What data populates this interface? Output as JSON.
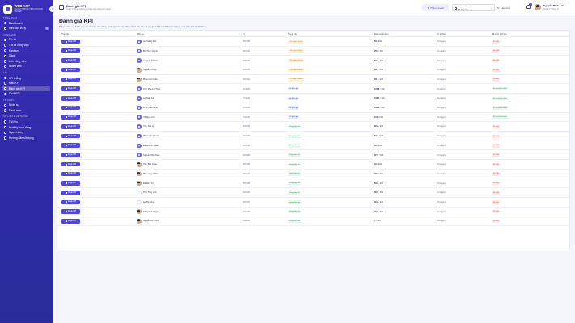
{
  "brand": {
    "name": "WEB APP",
    "subtitle": "QUẢN LÝ NHÂN VIÊN CHUYÊN NGHIỆP"
  },
  "sidebar": {
    "sections": [
      {
        "label": "TỔNG QUAN",
        "items": [
          {
            "label": "Dashboard",
            "active": false
          },
          {
            "label": "Việc cần xử lý",
            "active": false,
            "badge": "3"
          }
        ]
      },
      {
        "label": "CÔNG VIỆC",
        "items": [
          {
            "label": "Dự án",
            "active": false
          },
          {
            "label": "Tất cả công việc",
            "active": false
          },
          {
            "label": "Kanban",
            "active": false
          },
          {
            "label": "Gantt",
            "active": false
          },
          {
            "label": "Lịch công việc",
            "active": false
          },
          {
            "label": "Nhiều việc",
            "active": false
          }
        ]
      },
      {
        "label": "KPI",
        "items": [
          {
            "label": "KPI thẳng",
            "active": false
          },
          {
            "label": "Mẫu KPI",
            "active": false
          },
          {
            "label": "Đánh giá KPI",
            "active": true
          },
          {
            "label": "Chốt KPI",
            "active": false
          }
        ]
      },
      {
        "label": "TỔ CHỨC",
        "items": [
          {
            "label": "Nhân sự",
            "active": false
          },
          {
            "label": "Danh mục",
            "active": false
          }
        ]
      },
      {
        "label": "DỮ LIỆU & HỆ THỐNG",
        "items": [
          {
            "label": "Tài liệu",
            "active": false
          },
          {
            "label": "Nhật ký hoạt động",
            "active": false
          },
          {
            "label": "Người dùng",
            "active": false
          },
          {
            "label": "Hướng dẫn sử dụng",
            "active": false
          }
        ]
      }
    ]
  },
  "topbar": {
    "title": "Đánh giá KPI",
    "subtitle": "Quản lý đánh giá quy chỉ tiêu cho nhân viên hàng",
    "action_label": "Thêm nhanh",
    "month_label": "Chọn tháng",
    "month_value": "Tháng này",
    "refresh_label": "Làm mới",
    "notif_count": "3",
    "user_name": "Nguyễn Minh Anh",
    "user_role": "Quản lý | Quản trị"
  },
  "page": {
    "title": "Đánh giá KPI",
    "description": "Phiên nhân sự đánh giá các chỉ tiêu cần thiệp, quản lý kiểm tra, điều chỉnh kết cần và duyệt. Chỉ sau khi bản hài lòng, mới tính KPI chính thức."
  },
  "table": {
    "headers": [
      "Thao tác",
      "Nhân sự",
      "Kỳ",
      "Trạng thái",
      "Điểm hoàn thiện",
      "Xử lý/thao",
      "Đã hoàn tất/chưa"
    ],
    "action_label": "Duyệt KPI",
    "rows": [
      {
        "name": "Lê Hoàng Sơn",
        "avatar": "init",
        "period": "06/2026",
        "status": "Chờ quản lý duyệt",
        "status_type": "wait",
        "score": "53",
        "max": "/ 100",
        "handling": "Chưa gửi",
        "completion": "Đã chốt",
        "completion_type": "no"
      },
      {
        "name": "Bùi Thúy Quỳnh",
        "avatar": "init",
        "period": "06/2026",
        "status": "Chờ quản lý duyệt",
        "status_type": "wait",
        "score": "25.6",
        "max": "/ 100",
        "handling": "Chưa gửi",
        "completion": "Đã chốt",
        "completion_type": "no"
      },
      {
        "name": "Lê Quốc Khánh",
        "avatar": "init",
        "period": "06/2026",
        "status": "Chờ quản lý duyệt",
        "status_type": "wait",
        "score": "69.8",
        "max": "/ 100",
        "handling": "Chưa gửi",
        "completion": "Đã chốt",
        "completion_type": "no"
      },
      {
        "name": "Nguyễn Hà My",
        "avatar": "photo",
        "period": "06/2026",
        "status": "Chờ quản lý duyệt",
        "status_type": "wait",
        "score": "93.1",
        "max": "/ 100",
        "handling": "Chưa gửi",
        "completion": "Đã chốt",
        "completion_type": "no"
      },
      {
        "name": "Phạm Anh Tuấn",
        "avatar": "photo",
        "period": "06/2026",
        "status": "Chờ quản lý duyệt",
        "status_type": "wait",
        "score": "53.1",
        "max": "/ 100",
        "handling": "Chưa gửi",
        "completion": "Đã chốt",
        "completion_type": "no"
      },
      {
        "name": "Trần Phương Thảo",
        "avatar": "init",
        "period": "07/2026",
        "status": "Đã đánh giá",
        "status_type": "done",
        "score": "101.5",
        "max": "/ 100",
        "handling": "Chưa gửi",
        "completion": "Đã có ý kiến nhập",
        "completion_type": "ok"
      },
      {
        "name": "Lê Tuấn Anh",
        "avatar": "init",
        "period": "07/2026",
        "status": "Đã đánh giá",
        "status_type": "done",
        "score": "103.1",
        "max": "/ 100",
        "handling": "Chưa gửi",
        "completion": "Đã có ý kiến nhập",
        "completion_type": "ok"
      },
      {
        "name": "Phạm Bảo Minh",
        "avatar": "init",
        "period": "07/2026",
        "status": "Đã đánh giá",
        "status_type": "done",
        "score": "102.3",
        "max": "/ 100",
        "handling": "Chưa gửi",
        "completion": "Đã có ý kiến nhập",
        "completion_type": "ok"
      },
      {
        "name": "Võ Ngọc Anh",
        "avatar": "init",
        "period": "07/2026",
        "status": "Đã đánh giá",
        "status_type": "done",
        "score": "101",
        "max": "/ 100",
        "handling": "Chưa gửi",
        "completion": "Đã có ý kiến nhập",
        "completion_type": "ok"
      },
      {
        "name": "Trần Kim Ly",
        "avatar": "init",
        "period": "06/2026",
        "status": "Đang theo dõi",
        "status_type": "none",
        "score": "66.8",
        "max": "/ 100",
        "handling": "Chưa gửi",
        "completion": "Đã chốt",
        "completion_type": "no"
      },
      {
        "name": "Phạm Văn Phong",
        "avatar": "init",
        "period": "06/2026",
        "status": "Đang theo dõi",
        "status_type": "none",
        "score": "54.6",
        "max": "/ 100",
        "handling": "Chưa gửi",
        "completion": "Đã chốt",
        "completion_type": "no"
      },
      {
        "name": "Đặng Đình Quân",
        "avatar": "init",
        "period": "06/2026",
        "status": "Đang theo dõi",
        "status_type": "none",
        "score": "46",
        "max": "/ 100",
        "handling": "Chưa gửi",
        "completion": "Đã chốt",
        "completion_type": "no"
      },
      {
        "name": "Nguyễn Hiền Nam",
        "avatar": "init",
        "period": "06/2026",
        "status": "Đang theo dõi",
        "status_type": "none",
        "score": "37.5",
        "max": "/ 100",
        "handling": "Chưa gửi",
        "completion": "Đã chốt",
        "completion_type": "no"
      },
      {
        "name": "Trần Bảo Châu",
        "avatar": "photo",
        "period": "06/2026",
        "status": "Đang theo dõi",
        "status_type": "none",
        "score": "41",
        "max": "/ 100",
        "handling": "Chưa gửi",
        "completion": "Đã chốt",
        "completion_type": "no"
      },
      {
        "name": "Phạm Ngọc Hân",
        "avatar": "photo",
        "period": "06/2026",
        "status": "Đang theo dõi",
        "status_type": "none",
        "score": "49.5",
        "max": "/ 100",
        "handling": "Chưa gửi",
        "completion": "Đã chốt",
        "completion_type": "no"
      },
      {
        "name": "Đỗ Minh Trí",
        "avatar": "photo",
        "period": "06/2026",
        "status": "Đang theo dõi",
        "status_type": "none",
        "score": "53.6",
        "max": "/ 100",
        "handling": "Chưa gửi",
        "completion": "Đã chốt",
        "completion_type": "no"
      },
      {
        "name": "Trần Thùy Linh",
        "avatar": "blank",
        "period": "06/2026",
        "status": "Đang theo dõi",
        "status_type": "none",
        "score": "56.5",
        "max": "/ 100",
        "handling": "Chưa gửi",
        "completion": "Đã chốt",
        "completion_type": "no"
      },
      {
        "name": "Lê Thị Vòng",
        "avatar": "blank",
        "period": "06/2026",
        "status": "Đang theo dõi",
        "status_type": "none",
        "score": "46.8",
        "max": "/ 100",
        "handling": "Chưa gửi",
        "completion": "Đã chốt",
        "completion_type": "no"
      },
      {
        "name": "Đặng Đình Ngọc",
        "avatar": "photo",
        "period": "06/2026",
        "status": "Đang theo dõi",
        "status_type": "none",
        "score": "46.9",
        "max": "/ 100",
        "handling": "Chưa gửi",
        "completion": "Đã chốt",
        "completion_type": "no"
      },
      {
        "name": "Nguyễn Minh Anh",
        "avatar": "photo",
        "period": "06/2026",
        "status": "Đang theo dõi",
        "status_type": "none",
        "score": "0",
        "max": "/ 100",
        "handling": "Chưa gửi",
        "completion": "Đã chốt",
        "completion_type": "no"
      }
    ]
  },
  "colors": {
    "sidebar": "#3a2fb8",
    "accent": "#4f46e5",
    "background": "#f4f5fb"
  }
}
